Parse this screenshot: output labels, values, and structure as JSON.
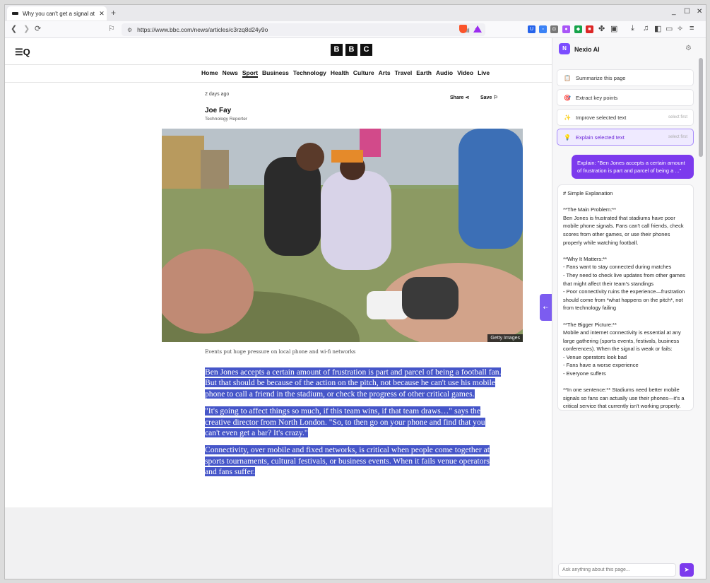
{
  "browser": {
    "tab_title": "Why you can't get a signal at",
    "tab_close": "✕",
    "new_tab": "+",
    "url": "https://www.bbc.com/news/articles/c3rzq8d24y9o",
    "min": "_",
    "max": "☐",
    "close": "✕"
  },
  "site": {
    "menu_icon": "☰Q",
    "logo": [
      "B",
      "B",
      "C"
    ],
    "nav": [
      "Home",
      "News",
      "Sport",
      "Business",
      "Technology",
      "Health",
      "Culture",
      "Arts",
      "Travel",
      "Earth",
      "Audio",
      "Video",
      "Live"
    ],
    "active_nav": "Sport"
  },
  "article": {
    "date": "2 days ago",
    "share_label": "Share",
    "save_label": "Save",
    "author": "Joe Fay",
    "role": "Technology Reporter",
    "photo_credit": "Getty Images",
    "caption": "Events put huge pressure on local phone and wi-fi networks",
    "paragraphs": [
      "Ben Jones accepts a certain amount of frustration is part and parcel of being a football fan. But that should be because of the action on the pitch, not because he can't use his mobile phone to call a friend in the stadium, or check the progress of other critical games.",
      "\"It's going to affect things so much, if this team wins, if that team draws…\" says the creative director from North London. \"So, to then go on your phone and find that you can't even get a bar? It's crazy.\"",
      "Connectivity, over mobile and fixed networks, is critical when people come together at sports tournaments, cultural festivals, or business events. When it fails venue operators and fans suffer."
    ]
  },
  "panel": {
    "logo_letter": "N",
    "title": "Nexio AI",
    "actions": [
      {
        "icon": "📋",
        "label": "Summarize this page",
        "hint": ""
      },
      {
        "icon": "🎯",
        "label": "Extract key points",
        "hint": ""
      },
      {
        "icon": "✨",
        "label": "Improve selected text",
        "hint": "select first"
      },
      {
        "icon": "💡",
        "label": "Explain selected text",
        "hint": "select first"
      }
    ],
    "user_message": "Explain: \"Ben Jones accepts a certain amount of frustration is part and parcel of being a ...\"",
    "ai_response": "# Simple Explanation\n\n**The Main Problem:**\nBen Jones is frustrated that stadiums have poor mobile phone signals. Fans can't call friends, check scores from other games, or use their phones properly while watching football.\n\n**Why It Matters:**\n- Fans want to stay connected during matches\n- They need to check live updates from other games that might affect their team's standings\n- Poor connectivity ruins the experience—frustration should come from *what happens on the pitch*, not from technology failing\n\n**The Bigger Picture:**\nMobile and internet connectivity is essential at any large gathering (sports events, festivals, business conferences). When the signal is weak or fails:\n- Venue operators look bad\n- Fans have a worse experience\n- Everyone suffers\n\n**In one sentence:** Stadiums need better mobile signals so fans can actually use their phones—it's a critical service that currently isn't working properly.",
    "input_placeholder": "Ask anything about this page...",
    "send_icon": "➤"
  }
}
